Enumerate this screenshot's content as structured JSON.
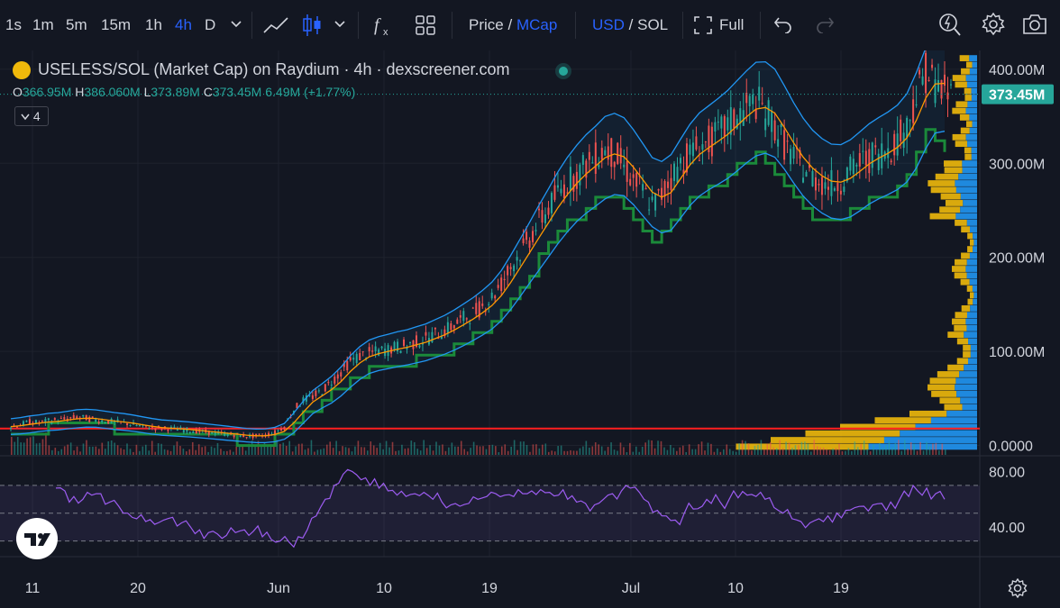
{
  "toolbar": {
    "timeframes": [
      "1s",
      "1m",
      "5m",
      "15m",
      "1h",
      "4h",
      "D"
    ],
    "active_timeframe": "4h",
    "price_label": "Price",
    "slash": "/",
    "mcap_label": "MCap",
    "usd_label": "USD",
    "sol_label": "SOL",
    "full_label": "Full"
  },
  "legend": {
    "title": "USELESS/SOL (Market Cap) on Raydium · 4h · dexscreener.com",
    "o_key": "O",
    "o_val": "366.95M",
    "h_key": "H",
    "h_val": "386.060M",
    "l_key": "L",
    "l_val": "373.89M",
    "c_key": "C",
    "c_val": "373.45M",
    "change": "6.49M (+1.77%)",
    "indicators_count": "4"
  },
  "colors": {
    "background": "#131722",
    "up": "#26a69a",
    "down": "#ef5350",
    "accent": "#2962ff",
    "bollinger": "#2196f3",
    "ma": "#ff9800",
    "supertrend_up": "#1b8a3a",
    "supertrend_down": "#8b1a1a",
    "rsi": "#9c5cf0",
    "hline": "#ff1f1f",
    "vp_up": "#2196f3",
    "vp_down": "#f0b90b"
  },
  "chart_data": {
    "type": "line",
    "title": "USELESS/SOL (Market Cap) on Raydium · 4h · dexscreener.com",
    "x_ticks": [
      "11",
      "20",
      "Jun",
      "10",
      "19",
      "Jul",
      "10",
      "19"
    ],
    "y_ticks": [
      "400.00M",
      "300.00M",
      "200.00M",
      "100.00M",
      "0.0000"
    ],
    "ylim": [
      -10,
      420
    ],
    "y_unit": "M",
    "last_price_label": "373.45M",
    "last_price": 373.45,
    "hline_value": 18,
    "series": [
      {
        "values": [
          20,
          22,
          25,
          24,
          26,
          27,
          28,
          30,
          29,
          27,
          26,
          25,
          24,
          22,
          20,
          19,
          18,
          18,
          17,
          16,
          15,
          14,
          13,
          12,
          11,
          10,
          10,
          11,
          14,
          20,
          38,
          48,
          52,
          58,
          68,
          78,
          90,
          95,
          98,
          100,
          102,
          105,
          106,
          110,
          113,
          118,
          122,
          128,
          135,
          140,
          148,
          158,
          172,
          190,
          205,
          220,
          238,
          252,
          268,
          280,
          288,
          298,
          305,
          315,
          310,
          296,
          282,
          270,
          256,
          266,
          285,
          300,
          310,
          318,
          322,
          330,
          340,
          350,
          358,
          365,
          355,
          340,
          320,
          305,
          295,
          285,
          280,
          278,
          282,
          292,
          300,
          306,
          310,
          316,
          325,
          340,
          372,
          396,
          385,
          374
        ]
      }
    ],
    "rsi": {
      "ylim": [
        20,
        90
      ],
      "y_ticks": [
        "80.00",
        "40.00"
      ],
      "band_upper": 70,
      "band_mid": 50,
      "band_lower": 30,
      "values": [
        68,
        66,
        62,
        60,
        63,
        64,
        58,
        55,
        50,
        46,
        44,
        42,
        45,
        47,
        43,
        40,
        38,
        36,
        35,
        34,
        36,
        38,
        37,
        33,
        31,
        30,
        29,
        33,
        38,
        48,
        60,
        70,
        78,
        80,
        74,
        70,
        68,
        66,
        63,
        62,
        64,
        65,
        60,
        58,
        56,
        55,
        57,
        60,
        62,
        64,
        63,
        62,
        64,
        66,
        67,
        65,
        63,
        60,
        58,
        57,
        56,
        60,
        64,
        66,
        68,
        65,
        58,
        52,
        48,
        45,
        50,
        53,
        55,
        57,
        58,
        60,
        61,
        63,
        62,
        60,
        54,
        50,
        46,
        44,
        43,
        46,
        48,
        50,
        52,
        54,
        55,
        56,
        57,
        58,
        60,
        62,
        66,
        68,
        64,
        60
      ]
    }
  }
}
